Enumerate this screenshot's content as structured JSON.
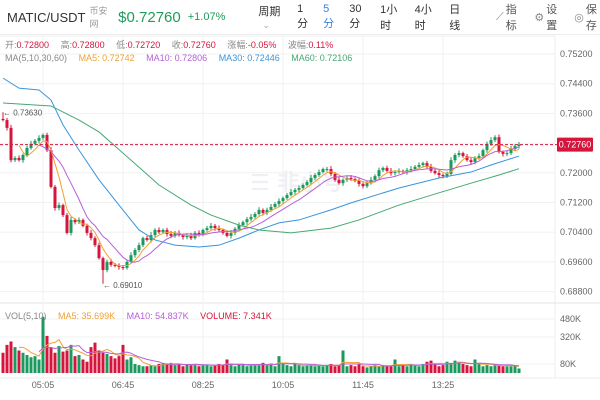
{
  "header": {
    "symbol": "MATIC/USDT",
    "source": "币安网",
    "price": "$0.72760",
    "change": "+1.07%",
    "period_label": "周期",
    "intervals": [
      {
        "label": "1分",
        "active": false
      },
      {
        "label": "5分",
        "active": true
      },
      {
        "label": "30分",
        "active": false
      },
      {
        "label": "1小时",
        "active": false
      },
      {
        "label": "4小时",
        "active": false
      },
      {
        "label": "日线",
        "active": false
      }
    ],
    "tools": [
      {
        "icon": "indicator-chart-icon",
        "label": "指标"
      },
      {
        "icon": "gear-icon",
        "label": "设置"
      },
      {
        "icon": "save-icon",
        "label": "保存"
      }
    ]
  },
  "ohlc_info": {
    "open_label": "开:",
    "open": "0.72800",
    "high_label": "高:",
    "high": "0.72800",
    "low_label": "低:",
    "low": "0.72720",
    "close_label": "收:",
    "close": "0.72760",
    "change_label": "涨幅:",
    "change": "-0.05%",
    "amp_label": "波幅:",
    "amp": "0.11%"
  },
  "ma_info": {
    "label": "MA(5,10,30,60)",
    "ma5": "MA5: 0.72742",
    "ma10": "MA10: 0.72806",
    "ma30": "MA30: 0.72446",
    "ma60": "MA60: 0.72106"
  },
  "vol_info": {
    "label": "VOL(5,10)",
    "ma5": "MA5: 35.699K",
    "ma10": "MA10: 54.837K",
    "volume": "VOLUME: 7.341K"
  },
  "colors": {
    "up": "#1a9a5c",
    "down": "#d6143c",
    "ma5": "#f0a030",
    "ma10": "#b55fd8",
    "ma30": "#3a94dc",
    "ma60": "#45a872",
    "accent": "#3b7de0"
  },
  "chart_data": {
    "type": "candlestick",
    "interval": "5分",
    "y_ticks": [
      "0.75200",
      "0.74400",
      "0.73600",
      "0.72800",
      "0.72000",
      "0.71200",
      "0.70400",
      "0.69600",
      "0.68800"
    ],
    "ylim": [
      0.6856,
      0.7539
    ],
    "x_ticks": [
      "05:05",
      "06:45",
      "08:25",
      "10:05",
      "11:45",
      "13:25"
    ],
    "start_time": "04:15",
    "last_price": "0.72760",
    "high_marker": "0.73630",
    "low_marker": "0.69010",
    "first_open": 0.7345,
    "closes": [
      0.7342,
      0.7321,
      0.7234,
      0.724,
      0.7234,
      0.7248,
      0.7267,
      0.7278,
      0.7286,
      0.7294,
      0.7302,
      0.7261,
      0.7162,
      0.7105,
      0.7113,
      0.7086,
      0.7038,
      0.7073,
      0.7067,
      0.7073,
      0.7057,
      0.7038,
      0.7024,
      0.7005,
      0.697,
      0.6938,
      0.696,
      0.6952,
      0.6949,
      0.6946,
      0.6944,
      0.696,
      0.6978,
      0.6992,
      0.7005,
      0.7024,
      0.7019,
      0.7032,
      0.7046,
      0.704,
      0.7046,
      0.7035,
      0.703,
      0.7038,
      0.7032,
      0.7027,
      0.703,
      0.7024,
      0.7038,
      0.7035,
      0.7046,
      0.7051,
      0.7057,
      0.7051,
      0.7046,
      0.7038,
      0.703,
      0.7038,
      0.7049,
      0.7059,
      0.7067,
      0.7075,
      0.7081,
      0.7089,
      0.71,
      0.7092,
      0.71,
      0.7108,
      0.7116,
      0.7124,
      0.7132,
      0.714,
      0.7148,
      0.7154,
      0.7159,
      0.7167,
      0.7175,
      0.7186,
      0.7194,
      0.7202,
      0.721,
      0.721,
      0.7197,
      0.7181,
      0.7172,
      0.7181,
      0.7186,
      0.7183,
      0.7178,
      0.717,
      0.7164,
      0.7172,
      0.7181,
      0.7191,
      0.7207,
      0.7213,
      0.7205,
      0.7199,
      0.7202,
      0.7205,
      0.7202,
      0.7207,
      0.721,
      0.7216,
      0.7221,
      0.7226,
      0.7216,
      0.7205,
      0.7199,
      0.7194,
      0.7191,
      0.7197,
      0.7234,
      0.7248,
      0.7253,
      0.7245,
      0.7234,
      0.7229,
      0.724,
      0.7245,
      0.7261,
      0.7278,
      0.7288,
      0.7296,
      0.7256,
      0.7251,
      0.7253,
      0.7264,
      0.7272,
      0.7276
    ],
    "ma30": [
      [
        "04:15",
        0.7455
      ],
      [
        "04:35",
        0.7428
      ],
      [
        "05:00",
        0.7423
      ],
      [
        "05:15",
        0.7396
      ],
      [
        "05:30",
        0.7329
      ],
      [
        "05:50",
        0.7261
      ],
      [
        "06:15",
        0.7181
      ],
      [
        "06:40",
        0.7113
      ],
      [
        "07:05",
        0.7046
      ],
      [
        "07:25",
        0.7019
      ],
      [
        "07:50",
        0.7005
      ],
      [
        "08:20",
        0.7
      ],
      [
        "08:45",
        0.7005
      ],
      [
        "09:10",
        0.7024
      ],
      [
        "09:35",
        0.7046
      ],
      [
        "10:00",
        0.7065
      ],
      [
        "10:25",
        0.7073
      ],
      [
        "11:05",
        0.71
      ],
      [
        "11:30",
        0.7119
      ],
      [
        "12:30",
        0.7159
      ],
      [
        "13:20",
        0.7186
      ],
      [
        "14:00",
        0.7202
      ],
      [
        "14:25",
        0.7221
      ],
      [
        "15:00",
        0.7245
      ]
    ],
    "ma60": [
      [
        "04:15",
        0.7388
      ],
      [
        "05:15",
        0.738
      ],
      [
        "05:50",
        0.7342
      ],
      [
        "06:15",
        0.731
      ],
      [
        "06:55",
        0.7234
      ],
      [
        "07:30",
        0.7167
      ],
      [
        "08:10",
        0.7113
      ],
      [
        "08:35",
        0.7086
      ],
      [
        "09:10",
        0.7059
      ],
      [
        "09:35",
        0.7046
      ],
      [
        "10:15",
        0.7038
      ],
      [
        "11:05",
        0.7051
      ],
      [
        "11:40",
        0.7073
      ],
      [
        "12:30",
        0.7113
      ],
      [
        "13:20",
        0.7146
      ],
      [
        "14:00",
        0.7172
      ],
      [
        "14:35",
        0.7194
      ],
      [
        "15:00",
        0.7211
      ]
    ],
    "volume_ticks": [
      "480K",
      "320K",
      "80K"
    ],
    "volumes_k": [
      180,
      250,
      280,
      230,
      200,
      180,
      160,
      140,
      150,
      120,
      500,
      330,
      230,
      180,
      240,
      190,
      200,
      250,
      150,
      160,
      120,
      100,
      230,
      270,
      200,
      180,
      170,
      150,
      130,
      150,
      250,
      120,
      140,
      80,
      70,
      60,
      60,
      70,
      60,
      80,
      90,
      85,
      90,
      70,
      80,
      60,
      75,
      70,
      80,
      60,
      70,
      75,
      60,
      70,
      80,
      70,
      120,
      70,
      60,
      80,
      70,
      60,
      75,
      70,
      80,
      90,
      70,
      85,
      60,
      150,
      80,
      70,
      60,
      80,
      70,
      60,
      70,
      70,
      60,
      75,
      60,
      70,
      80,
      60,
      70,
      200,
      60,
      70,
      60,
      75,
      60,
      50,
      60,
      70,
      60,
      70,
      60,
      60,
      120,
      60,
      70,
      60,
      80,
      70,
      60,
      80,
      100,
      110,
      80,
      60,
      70,
      100,
      90,
      110,
      100,
      80,
      70,
      60,
      120,
      80,
      60,
      70,
      60,
      80,
      70,
      60,
      60,
      60,
      70,
      40
    ]
  }
}
